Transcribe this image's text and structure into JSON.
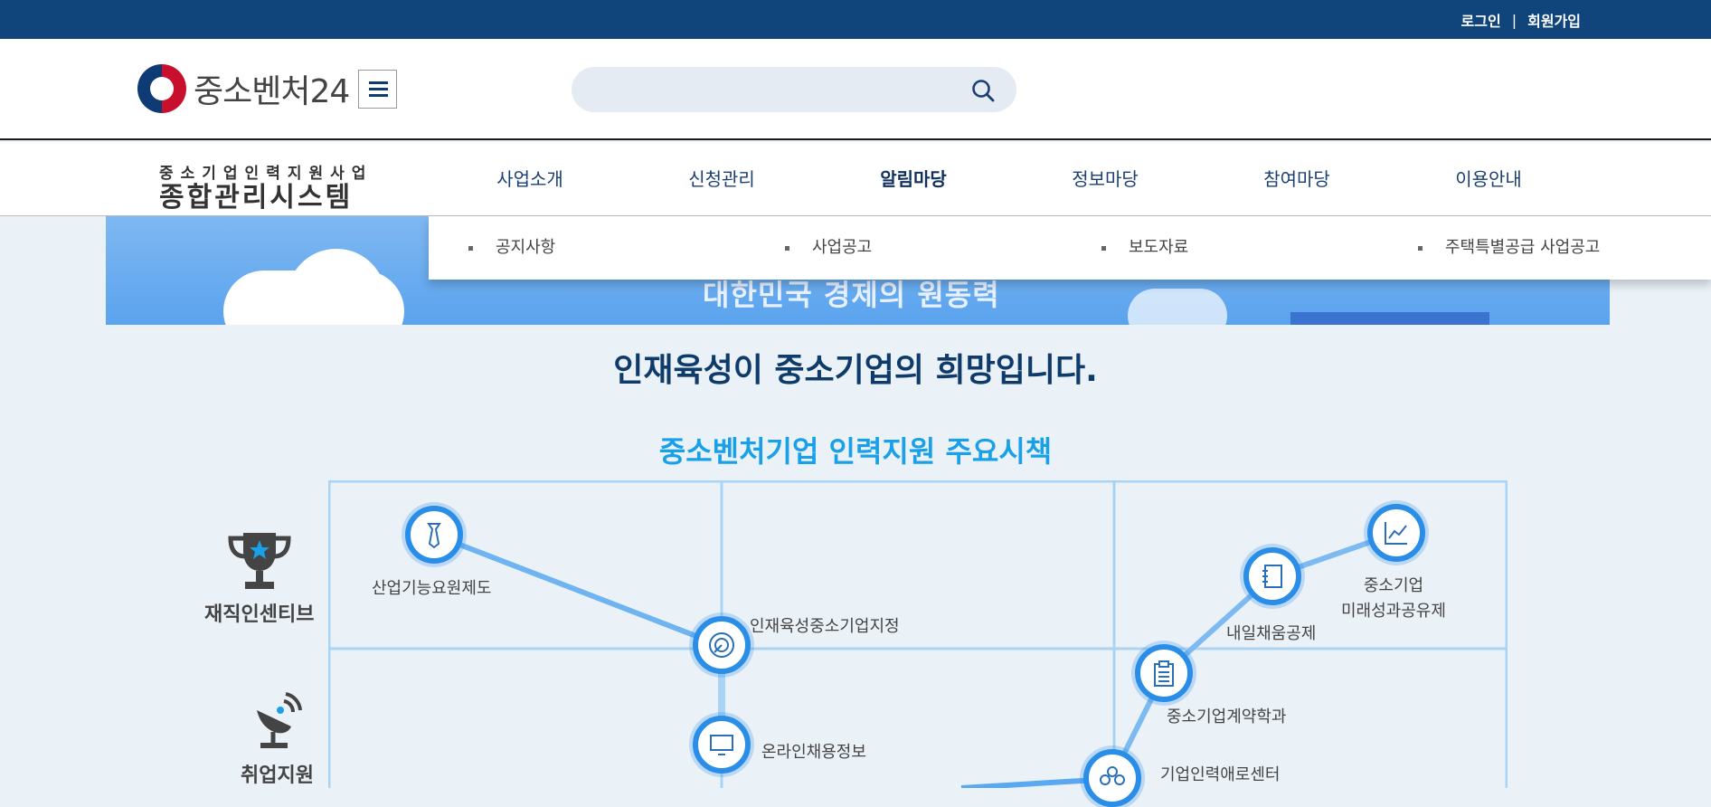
{
  "topbar": {
    "login": "로그인",
    "sep": "|",
    "signup": "회원가입"
  },
  "header": {
    "logo_text": "중소벤처24",
    "search_placeholder": ""
  },
  "system": {
    "subtitle": "중소기업인력지원사업",
    "title": "종합관리시스템"
  },
  "nav": {
    "items": [
      {
        "label": "사업소개"
      },
      {
        "label": "신청관리"
      },
      {
        "label": "알림마당",
        "active": true
      },
      {
        "label": "정보마당"
      },
      {
        "label": "참여마당"
      },
      {
        "label": "이용안내"
      }
    ],
    "submenu": [
      "공지사항",
      "사업공고",
      "보도자료",
      "주택특별공급 사업공고"
    ]
  },
  "banner": {
    "slogan": "대한민국 경제의 원동력"
  },
  "main": {
    "headline": "인재육성이 중소기업의 희망입니다.",
    "subhead": "중소벤처기업 인력지원 주요시책",
    "categories": [
      "재직인센티브",
      "취업지원"
    ],
    "policies": [
      "산업기능요원제도",
      "인재육성중소기업지정",
      "온라인채용정보",
      "내일채움공제",
      "중소기업\n미래성과공유제",
      "중소기업계약학과",
      "기업인력애로센터"
    ]
  },
  "colors": {
    "topbar": "#0f457a",
    "accent": "#2a8de8",
    "headline": "#0f3b6b",
    "subhead": "#1aa0e8"
  }
}
